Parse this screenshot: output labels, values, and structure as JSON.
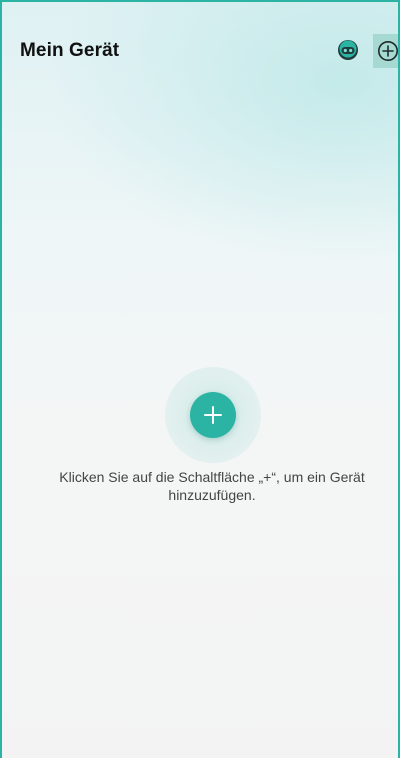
{
  "header": {
    "title": "Mein Gerät",
    "support_icon": "support-robot-icon",
    "add_icon": "circle-plus-icon"
  },
  "empty_state": {
    "add_icon": "plus-icon",
    "hint_text": "Klicken Sie auf die Schaltfläche „+“, um ein Gerät hinzuzufügen."
  },
  "colors": {
    "accent": "#2bb3a3",
    "title_text": "#111111",
    "hint_text": "#444444"
  }
}
